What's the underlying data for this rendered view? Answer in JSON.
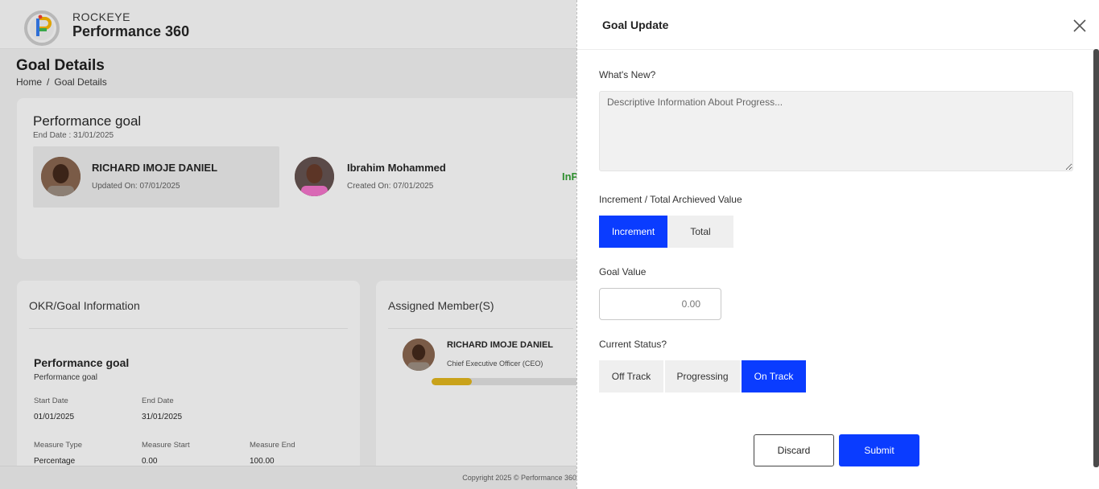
{
  "header": {
    "brand_small": "ROCKEYE",
    "brand_name": "Performance 360"
  },
  "page": {
    "title": "Goal Details",
    "breadcrumb": [
      "Home",
      "/",
      "Goal Details"
    ]
  },
  "goal_card": {
    "name": "Performance goal",
    "end_date": "End Date : 31/01/2025",
    "people": [
      {
        "name": "RICHARD IMOJE DANIEL",
        "date": "Updated On: 07/01/2025"
      },
      {
        "name": "Ibrahim Mohammed",
        "date": "Created On: 07/01/2025"
      }
    ],
    "status_partial": "InP"
  },
  "okr": {
    "header": "OKR/Goal Information",
    "title": "Performance goal",
    "subtitle": "Performance goal",
    "fields": [
      {
        "label": "Start Date",
        "value": "01/01/2025"
      },
      {
        "label": "End Date",
        "value": "31/01/2025"
      },
      {
        "label": "Measure Type",
        "value": "Percentage"
      },
      {
        "label": "Measure Start",
        "value": "0.00"
      },
      {
        "label": "Measure End",
        "value": "100.00"
      }
    ]
  },
  "assigned": {
    "header": "Assigned Member(S)",
    "member_name": "RICHARD IMOJE DANIEL",
    "member_role": "Chief Executive Officer (CEO)",
    "progress_fraction": 0.25
  },
  "footer": {
    "copyright": "Copyright 2025 © Performance 360"
  },
  "drawer": {
    "title": "Goal Update",
    "whats_new_label": "What's New?",
    "whats_new_placeholder": "Descriptive Information About Progress...",
    "increment_label": "Increment / Total Archieved Value",
    "increment_options": [
      "Increment",
      "Total"
    ],
    "increment_selected": "Increment",
    "goal_value_label": "Goal Value",
    "goal_value_placeholder": "0.00",
    "status_label": "Current Status?",
    "status_options": [
      "Off Track",
      "Progressing",
      "On Track"
    ],
    "status_selected": "On Track",
    "discard_label": "Discard",
    "submit_label": "Submit"
  },
  "colors": {
    "accent": "#0a3cff",
    "in_progress": "#2f8f2f",
    "progress_fill": "#c9a21a"
  }
}
